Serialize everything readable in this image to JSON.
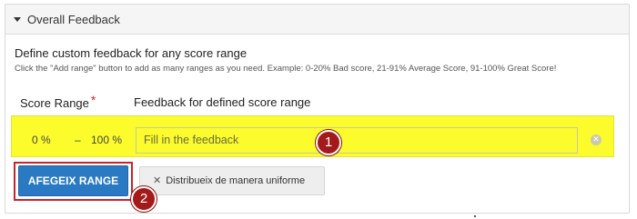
{
  "panel": {
    "title": "Overall Feedback"
  },
  "define": {
    "title": "Define custom feedback for any score range",
    "help": "Click the \"Add range\" button to add as many ranges as you need. Example: 0-20% Bad score, 21-91% Average Score, 91-100% Great Score!"
  },
  "columns": {
    "score_range": "Score Range",
    "required_mark": "*",
    "feedback": "Feedback for defined score range"
  },
  "range_row": {
    "from": "0 %",
    "dash": "–",
    "to": "100 %",
    "feedback_placeholder": "Fill in the feedback",
    "feedback_value": ""
  },
  "buttons": {
    "add_range": "AFEGEIX RANGE",
    "distribute": "Distribueix de manera uniforme",
    "distribute_icon_glyph": "✕"
  },
  "markers": {
    "one": "1",
    "two": "2"
  },
  "colors": {
    "highlight": "#fcfc2c",
    "primary": "#2a7ac3",
    "marker": "#a41a1a",
    "callout_border": "#c9242b"
  },
  "icons": {
    "caret": "caret-down-icon",
    "remove": "remove-circle-icon",
    "distribute": "close-icon"
  }
}
